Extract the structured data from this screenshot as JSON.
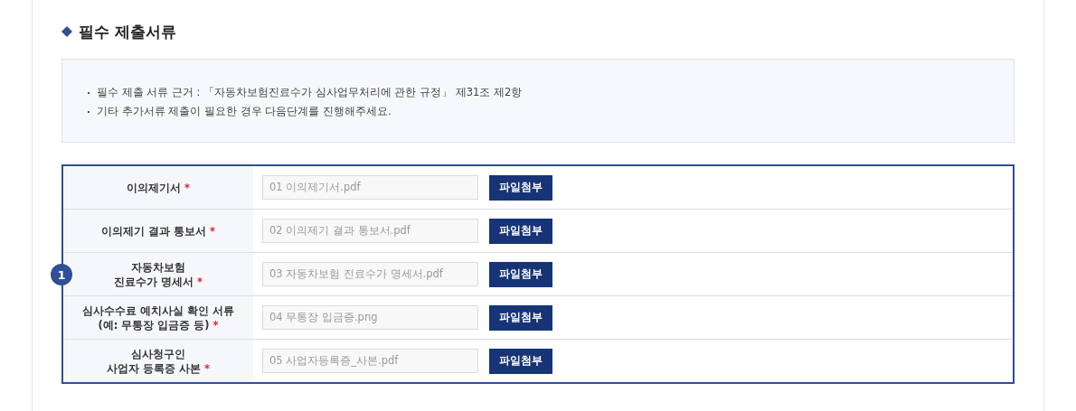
{
  "section": {
    "title": "필수 제출서류"
  },
  "notes": [
    "필수 제출 서류 근거 : 「자동차보험진료수가 심사업무처리에 관한 규정」 제31조 제2항",
    "기타 추가서류 제출이 필요한 경우 다음단계를 진행해주세요."
  ],
  "marker": "1",
  "required_mark": "*",
  "documents": [
    {
      "label": [
        "이의제기서"
      ],
      "required": true,
      "file": "01 이의제기서.pdf",
      "button": "파일첨부"
    },
    {
      "label": [
        "이의제기 결과 통보서"
      ],
      "required": true,
      "file": "02 이의제기 결과 통보서.pdf",
      "button": "파일첨부"
    },
    {
      "label": [
        "자동차보험",
        "진료수가 명세서"
      ],
      "required": true,
      "file": "03 자동차보험 진료수가 명세서.pdf",
      "button": "파일첨부"
    },
    {
      "label": [
        "심사수수료 예치사실 확인 서류",
        "(예: 무통장 입금증 등)"
      ],
      "required": true,
      "file": "04 무통장 입금증.png",
      "button": "파일첨부"
    },
    {
      "label": [
        "심사청구인",
        "사업자 등록증 사본"
      ],
      "required": true,
      "file": "05 사업자등록증_사본.pdf",
      "button": "파일첨부"
    }
  ]
}
